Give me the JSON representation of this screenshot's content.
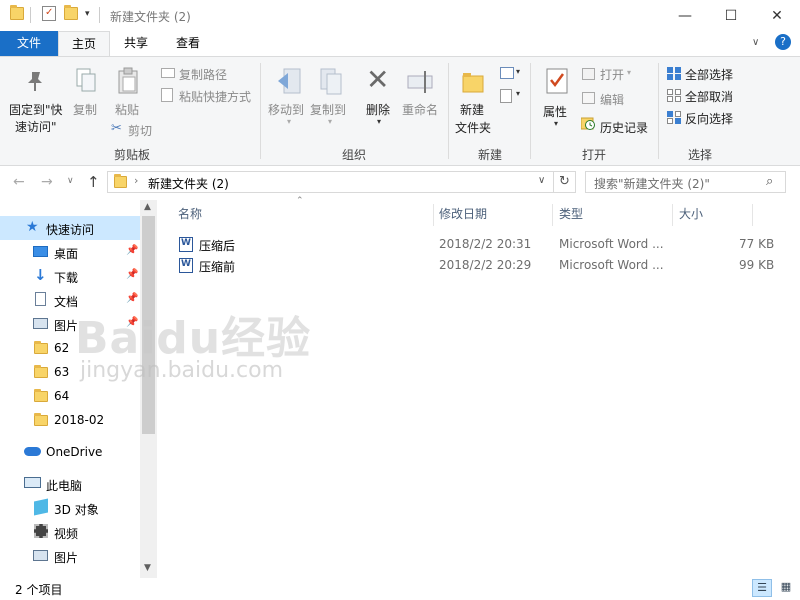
{
  "window": {
    "title": "新建文件夹 (2)",
    "controls": {
      "minimize": "—",
      "maximize": "☐",
      "close": "✕"
    }
  },
  "tabs": {
    "file": "文件",
    "home": "主页",
    "share": "共享",
    "view": "查看"
  },
  "ribbon": {
    "clipboard": {
      "pin": "固定到\"快",
      "pin2": "速访问\"",
      "copy": "复制",
      "paste": "粘贴",
      "copy_path": "复制路径",
      "paste_shortcut": "粘贴快捷方式",
      "cut": "剪切",
      "group": "剪贴板"
    },
    "organize": {
      "move_to": "移动到",
      "copy_to": "复制到",
      "delete": "删除",
      "rename": "重命名",
      "group": "组织"
    },
    "new": {
      "new_folder": "新建",
      "new_folder2": "文件夹",
      "group": "新建"
    },
    "open": {
      "properties": "属性",
      "open": "打开",
      "edit": "编辑",
      "history": "历史记录",
      "group": "打开"
    },
    "select": {
      "select_all": "全部选择",
      "select_none": "全部取消",
      "invert": "反向选择",
      "group": "选择"
    }
  },
  "address": {
    "path": "新建文件夹 (2)",
    "search_placeholder": "搜索\"新建文件夹 (2)\""
  },
  "nav": {
    "quick_access": "快速访问",
    "items": [
      "桌面",
      "下载",
      "文档",
      "图片",
      "62",
      "63",
      "64",
      "2018-02"
    ],
    "onedrive": "OneDrive",
    "this_pc": "此电脑",
    "pc_items": [
      "3D 对象",
      "视频",
      "图片"
    ]
  },
  "columns": {
    "name": "名称",
    "modified": "修改日期",
    "type": "类型",
    "size": "大小"
  },
  "files": [
    {
      "name": "压缩后",
      "modified": "2018/2/2 20:31",
      "type": "Microsoft Word ...",
      "size": "77 KB"
    },
    {
      "name": "压缩前",
      "modified": "2018/2/2 20:29",
      "type": "Microsoft Word ...",
      "size": "99 KB"
    }
  ],
  "status": {
    "count": "2 个项目"
  },
  "watermark": {
    "line1": "Baidu经验",
    "line2": "jingyan.baidu.com"
  },
  "colors": {
    "accent": "#1a6fc7",
    "folder": "#f8d468",
    "header_text": "#4c607a"
  }
}
